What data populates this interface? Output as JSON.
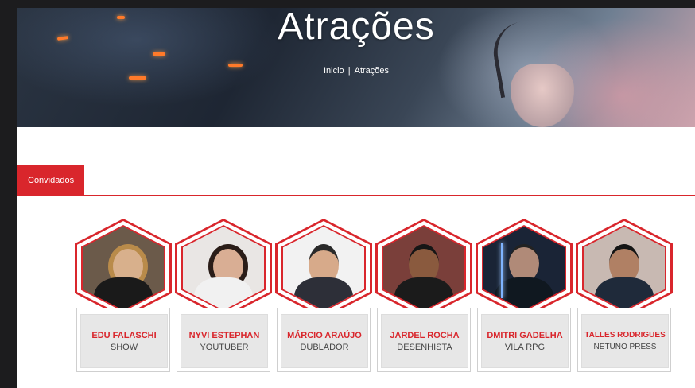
{
  "hero": {
    "title": "Atrações",
    "breadcrumb": {
      "home": "Inicio",
      "separator": "|",
      "current": "Atrações"
    }
  },
  "tabs": {
    "active_label": "Convidados"
  },
  "colors": {
    "accent": "#d9262c",
    "plate": "#e7e7e7"
  },
  "guests": [
    {
      "name": "EDU FALASCHI",
      "role": "SHOW"
    },
    {
      "name": "NYVI ESTEPHAN",
      "role": "YOUTUBER"
    },
    {
      "name": "MÁRCIO ARAÚJO",
      "role": "DUBLADOR"
    },
    {
      "name": "JARDEL ROCHA",
      "role": "DESENHISTA"
    },
    {
      "name": "DMITRI GADELHA",
      "role": "VILA RPG"
    },
    {
      "name": "TALLES RODRIGUES",
      "role": "NETUNO PRESS"
    }
  ]
}
